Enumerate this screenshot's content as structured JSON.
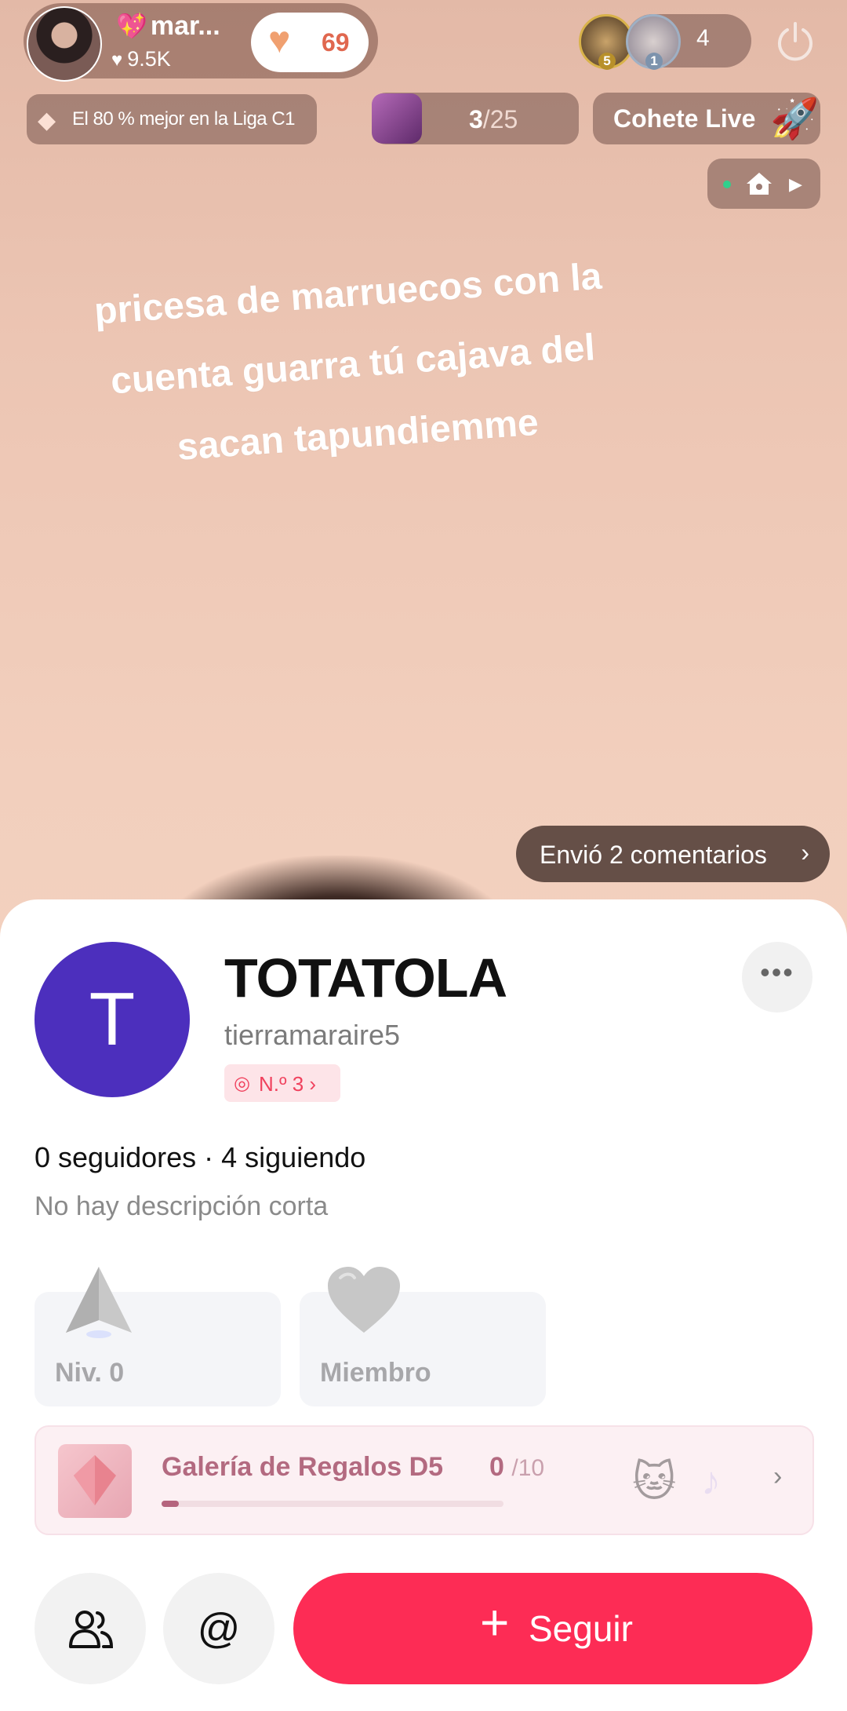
{
  "host": {
    "name": "mar...",
    "name_emoji": "💖",
    "likes": "9.5K",
    "likes_icon": "heart-icon",
    "heart_count": "69"
  },
  "viewers": {
    "ranks": [
      "5",
      "1"
    ],
    "count": "4"
  },
  "league": {
    "text": "El 80 % mejor en la Liga C1"
  },
  "ranking": {
    "current": "3",
    "total": "/25"
  },
  "rocket": {
    "label": "Cohete Live",
    "icon": "rocket-icon"
  },
  "overlay": {
    "text": "pricesa de marruecos con la cuenta guarra tú cajava del sacan tapundiemme"
  },
  "comments": {
    "label": "Envió 2 comentarios",
    "chevron": "›"
  },
  "profile": {
    "avatar_letter": "T",
    "display_name": "TOTATOLA",
    "username": "tierramaraire5",
    "rank_badge": "N.º 3 ›",
    "rank_badge_icon": "rank-medal-icon",
    "more": "•••",
    "follow_stats": "0 seguidores · 4 siguiendo",
    "bio": "No hay descripción corta"
  },
  "cards": {
    "level_label": "Niv. 0",
    "member_label": "Miembro"
  },
  "gift_gallery": {
    "title": "Galería de Regalos D5",
    "current": "0",
    "total": "/10",
    "progress_fraction": 0.05,
    "chevron": "›"
  },
  "actions": {
    "mention": "@",
    "follow_plus": "+",
    "follow_label": "Seguir"
  },
  "colors": {
    "follow_button": "#fd2c55",
    "avatar": "#4c2fbd",
    "rank_badge_text": "#f0415d",
    "gift_title": "#b36a80"
  }
}
